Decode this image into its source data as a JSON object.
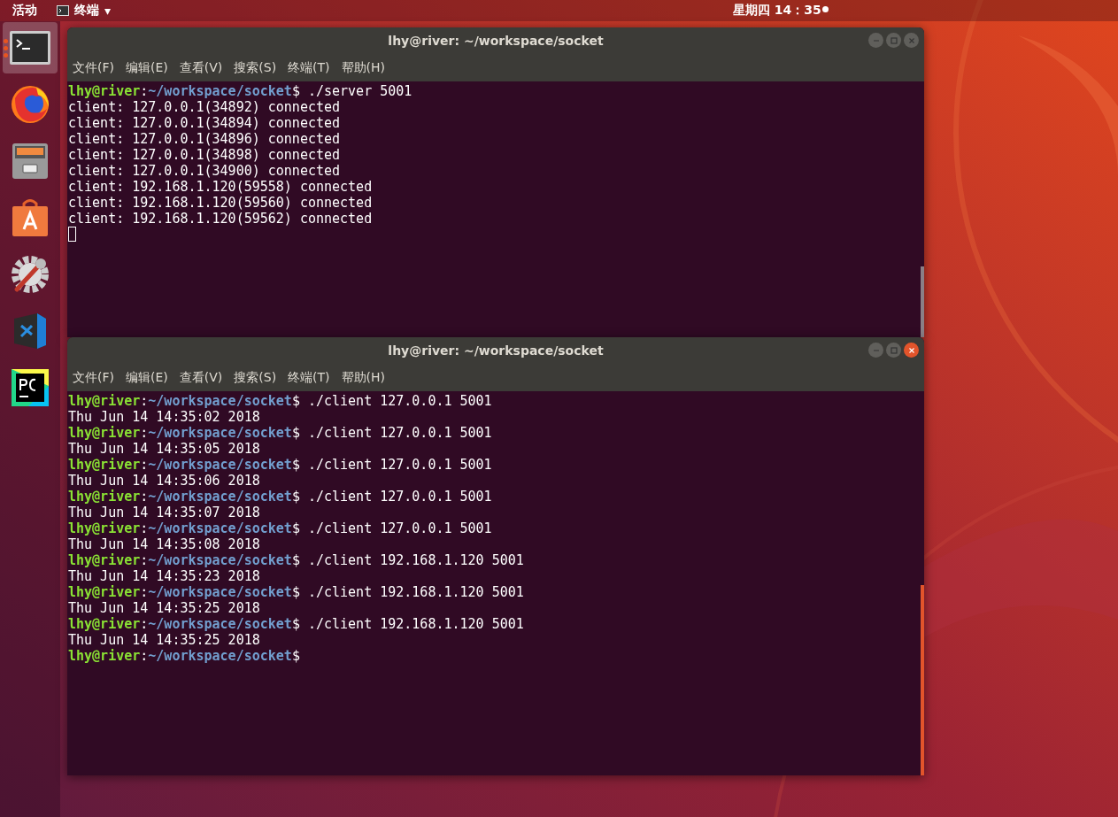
{
  "top_bar": {
    "activities": "活动",
    "app_menu": {
      "label": "终端",
      "caret": "▾"
    },
    "clock": "星期四 14：35"
  },
  "dock": [
    {
      "kind": "terminal",
      "selected": true,
      "running": true
    },
    {
      "kind": "firefox",
      "selected": false,
      "running": false
    },
    {
      "kind": "files",
      "selected": false,
      "running": false
    },
    {
      "kind": "software",
      "selected": false,
      "running": false
    },
    {
      "kind": "settings",
      "selected": false,
      "running": false
    },
    {
      "kind": "vscode",
      "selected": false,
      "running": false
    },
    {
      "kind": "pycharm",
      "selected": false,
      "running": false
    }
  ],
  "windows": [
    {
      "title": "lhy@river: ~/workspace/socket",
      "focused": false,
      "menu": [
        "文件(F)",
        "编辑(E)",
        "查看(V)",
        "搜索(S)",
        "终端(T)",
        "帮助(H)"
      ],
      "cursor": true,
      "lines": [
        {
          "kind": "prompt",
          "user": "lhy@river",
          "sep": ":",
          "path": "~/workspace/socket",
          "symbol": "$",
          "command": "./server 5001"
        },
        {
          "kind": "output",
          "text": "client: 127.0.0.1(34892) connected"
        },
        {
          "kind": "output",
          "text": "client: 127.0.0.1(34894) connected"
        },
        {
          "kind": "output",
          "text": "client: 127.0.0.1(34896) connected"
        },
        {
          "kind": "output",
          "text": "client: 127.0.0.1(34898) connected"
        },
        {
          "kind": "output",
          "text": "client: 127.0.0.1(34900) connected"
        },
        {
          "kind": "output",
          "text": "client: 192.168.1.120(59558) connected"
        },
        {
          "kind": "output",
          "text": "client: 192.168.1.120(59560) connected"
        },
        {
          "kind": "output",
          "text": "client: 192.168.1.120(59562) connected"
        }
      ]
    },
    {
      "title": "lhy@river: ~/workspace/socket",
      "focused": true,
      "menu": [
        "文件(F)",
        "编辑(E)",
        "查看(V)",
        "搜索(S)",
        "终端(T)",
        "帮助(H)"
      ],
      "cursor": false,
      "lines": [
        {
          "kind": "prompt",
          "user": "lhy@river",
          "sep": ":",
          "path": "~/workspace/socket",
          "symbol": "$",
          "command": "./client 127.0.0.1 5001"
        },
        {
          "kind": "output",
          "text": "Thu Jun 14 14:35:02 2018"
        },
        {
          "kind": "prompt",
          "user": "lhy@river",
          "sep": ":",
          "path": "~/workspace/socket",
          "symbol": "$",
          "command": "./client 127.0.0.1 5001"
        },
        {
          "kind": "output",
          "text": "Thu Jun 14 14:35:05 2018"
        },
        {
          "kind": "prompt",
          "user": "lhy@river",
          "sep": ":",
          "path": "~/workspace/socket",
          "symbol": "$",
          "command": "./client 127.0.0.1 5001"
        },
        {
          "kind": "output",
          "text": "Thu Jun 14 14:35:06 2018"
        },
        {
          "kind": "prompt",
          "user": "lhy@river",
          "sep": ":",
          "path": "~/workspace/socket",
          "symbol": "$",
          "command": "./client 127.0.0.1 5001"
        },
        {
          "kind": "output",
          "text": "Thu Jun 14 14:35:07 2018"
        },
        {
          "kind": "prompt",
          "user": "lhy@river",
          "sep": ":",
          "path": "~/workspace/socket",
          "symbol": "$",
          "command": "./client 127.0.0.1 5001"
        },
        {
          "kind": "output",
          "text": "Thu Jun 14 14:35:08 2018"
        },
        {
          "kind": "prompt",
          "user": "lhy@river",
          "sep": ":",
          "path": "~/workspace/socket",
          "symbol": "$",
          "command": "./client 192.168.1.120 5001"
        },
        {
          "kind": "output",
          "text": "Thu Jun 14 14:35:23 2018"
        },
        {
          "kind": "prompt",
          "user": "lhy@river",
          "sep": ":",
          "path": "~/workspace/socket",
          "symbol": "$",
          "command": "./client 192.168.1.120 5001"
        },
        {
          "kind": "output",
          "text": "Thu Jun 14 14:35:25 2018"
        },
        {
          "kind": "prompt",
          "user": "lhy@river",
          "sep": ":",
          "path": "~/workspace/socket",
          "symbol": "$",
          "command": "./client 192.168.1.120 5001"
        },
        {
          "kind": "output",
          "text": "Thu Jun 14 14:35:25 2018"
        },
        {
          "kind": "prompt",
          "user": "lhy@river",
          "sep": ":",
          "path": "~/workspace/socket",
          "symbol": "$"
        }
      ]
    }
  ]
}
